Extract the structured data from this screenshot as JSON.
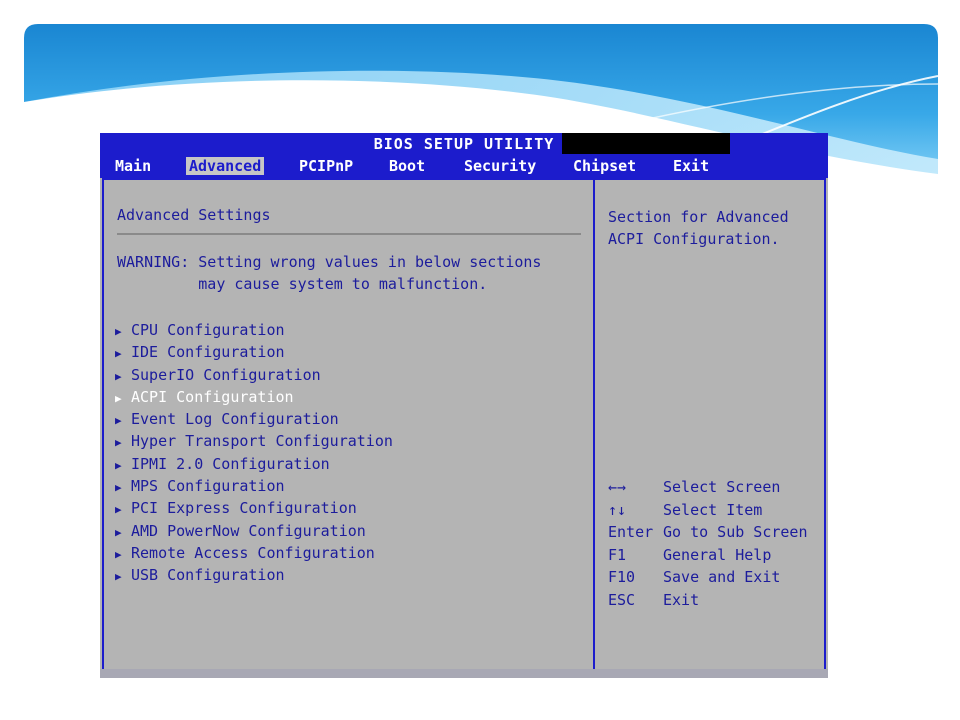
{
  "bios": {
    "title": "BIOS SETUP UTILITY",
    "menu": [
      {
        "label": "Main",
        "active": false
      },
      {
        "label": "Advanced",
        "active": true
      },
      {
        "label": "PCIPnP",
        "active": false
      },
      {
        "label": "Boot",
        "active": false
      },
      {
        "label": "Security",
        "active": false
      },
      {
        "label": "Chipset",
        "active": false
      },
      {
        "label": "Exit",
        "active": false
      }
    ],
    "section_title": "Advanced Settings",
    "warning_line1": "WARNING: Setting wrong values in below sections",
    "warning_line2": "         may cause system to malfunction.",
    "items": [
      {
        "label": "CPU Configuration",
        "selected": false
      },
      {
        "label": "IDE Configuration",
        "selected": false
      },
      {
        "label": "SuperIO Configuration",
        "selected": false
      },
      {
        "label": "ACPI Configuration",
        "selected": true
      },
      {
        "label": "Event Log Configuration",
        "selected": false
      },
      {
        "label": "Hyper Transport Configuration",
        "selected": false
      },
      {
        "label": "IPMI 2.0 Configuration",
        "selected": false
      },
      {
        "label": "MPS Configuration",
        "selected": false
      },
      {
        "label": "PCI Express Configuration",
        "selected": false
      },
      {
        "label": "AMD PowerNow Configuration",
        "selected": false
      },
      {
        "label": "Remote Access Configuration",
        "selected": false
      },
      {
        "label": "USB Configuration",
        "selected": false
      }
    ],
    "item_arrow": "▶",
    "help_line1": "Section for Advanced",
    "help_line2": "ACPI Configuration.",
    "keys": [
      {
        "key": "←→",
        "action": "Select Screen"
      },
      {
        "key": "↑↓",
        "action": "Select Item"
      },
      {
        "key": "Enter",
        "action": "Go to Sub Screen"
      },
      {
        "key": "F1",
        "action": "General Help"
      },
      {
        "key": "F10",
        "action": "Save and Exit"
      },
      {
        "key": "ESC",
        "action": "Exit"
      }
    ],
    "colors": {
      "blue": "#1c1ccc",
      "text_blue": "#1c1c9c",
      "panel_gray": "#b4b4b4",
      "selected_text": "#ffffff"
    }
  },
  "banner": {
    "colors": [
      "#1a8fd8",
      "#5cc1f2",
      "#9ad9f8"
    ]
  }
}
